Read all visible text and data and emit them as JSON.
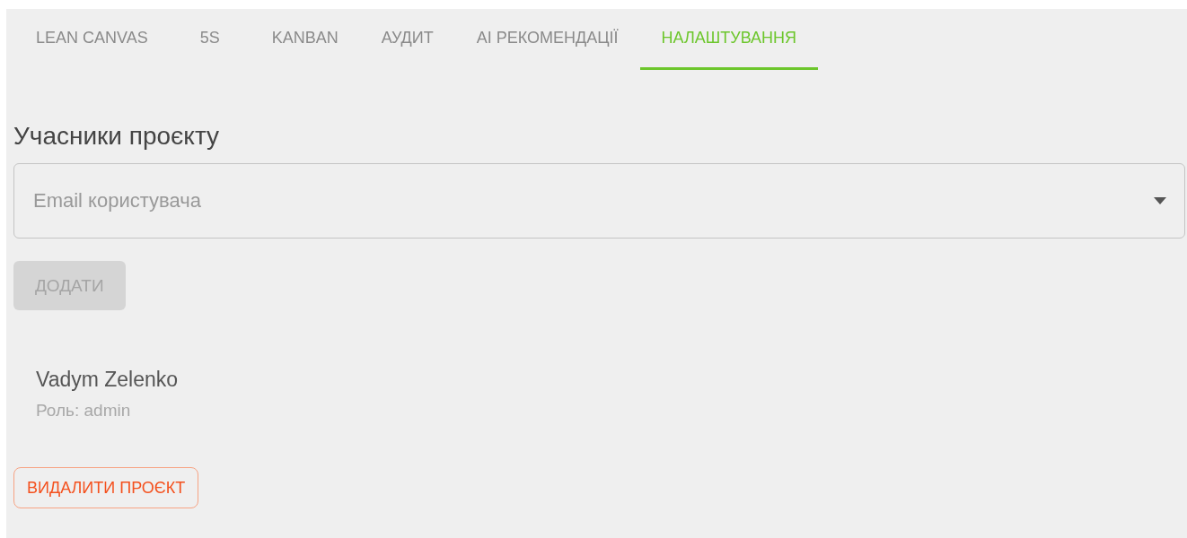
{
  "tabs": [
    {
      "label": "LEAN CANVAS",
      "selected": false
    },
    {
      "label": "5S",
      "selected": false
    },
    {
      "label": "KANBAN",
      "selected": false
    },
    {
      "label": "АУДИТ",
      "selected": false
    },
    {
      "label": "AI РЕКОМЕНДАЦІЇ",
      "selected": false
    },
    {
      "label": "НАЛАШТУВАННЯ",
      "selected": true
    }
  ],
  "members_section": {
    "title": "Учасники проєкту",
    "email_select": {
      "placeholder": "Email користувача"
    },
    "add_button": {
      "label": "ДОДАТИ",
      "disabled": true
    },
    "members": [
      {
        "name": "Vadym Zelenko",
        "role": "Роль: admin"
      }
    ]
  },
  "delete_button": {
    "label": "ВИДАЛИТИ ПРОЄКТ"
  }
}
